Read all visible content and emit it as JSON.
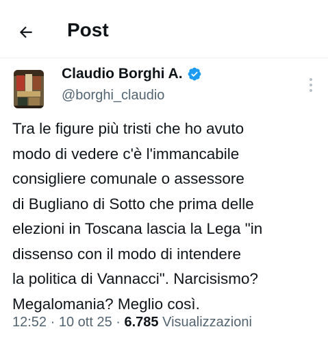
{
  "header": {
    "title": "Post",
    "back_icon": "arrow-left-icon"
  },
  "author": {
    "name": "Claudio Borghi A.",
    "handle": "@borghi_claudio",
    "verified_color": "#1d9bf0"
  },
  "post": {
    "lines": [
      "Tra le figure più tristi che ho avuto",
      "modo di vedere c'è l'immancabile",
      "consigliere comunale o assessore",
      "di Bugliano di Sotto che prima delle",
      "elezioni in Toscana lascia la Lega \"in",
      "dissenso con il modo di intendere",
      "la politica di Vannacci\". Narcisismo?",
      "Megalomania? Meglio così."
    ]
  },
  "meta": {
    "time": "12:52",
    "separator": "·",
    "date": "10 ott 25",
    "views_count": "6.785",
    "views_label": "Visualizzazioni"
  },
  "colors": {
    "text": "#0f1419",
    "secondary": "#536471",
    "divider": "#eff3f4"
  }
}
